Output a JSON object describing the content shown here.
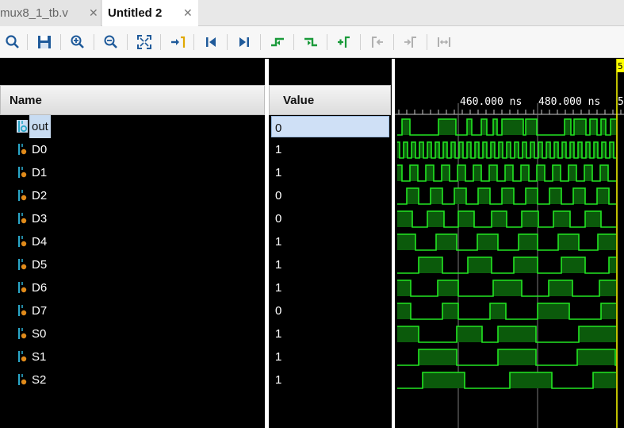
{
  "tabs": [
    {
      "label": "mux8_1_tb.v",
      "close": "✕"
    },
    {
      "label": "Untitled 2",
      "close": "✕"
    }
  ],
  "columns": {
    "name": "Name",
    "value": "Value"
  },
  "signals": [
    {
      "name": "out",
      "value": "0",
      "selected": true
    },
    {
      "name": "D0",
      "value": "1"
    },
    {
      "name": "D1",
      "value": "1"
    },
    {
      "name": "D2",
      "value": "0"
    },
    {
      "name": "D3",
      "value": "0"
    },
    {
      "name": "D4",
      "value": "1"
    },
    {
      "name": "D5",
      "value": "1"
    },
    {
      "name": "D6",
      "value": "1"
    },
    {
      "name": "D7",
      "value": "0"
    },
    {
      "name": "S0",
      "value": "1"
    },
    {
      "name": "S1",
      "value": "1"
    },
    {
      "name": "S2",
      "value": "1"
    }
  ],
  "timeline": {
    "labels": [
      "460.000 ns",
      "480.000 ns",
      "5"
    ],
    "cursor_label": "5"
  },
  "colors": {
    "wave": "#22e622",
    "wave_fill": "#0b5a0b",
    "cursor": "#ffff00"
  },
  "toolbar_icons": [
    "search-icon",
    "save-icon",
    "zoom-in-icon",
    "zoom-out-icon",
    "zoom-fit-icon",
    "go-to-cursor-icon",
    "go-to-time-zero-icon",
    "go-to-last-time-icon",
    "previous-transition-icon",
    "next-transition-icon",
    "add-marker-icon",
    "previous-marker-icon",
    "next-marker-icon",
    "swap-cursors-icon"
  ]
}
